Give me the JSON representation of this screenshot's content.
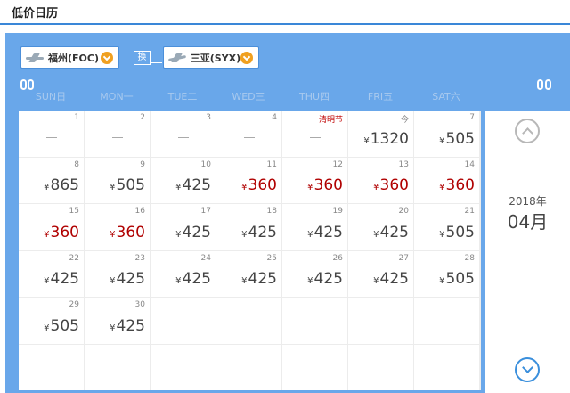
{
  "header": {
    "title": "低价日历"
  },
  "route": {
    "from": {
      "city": "福州(FOC)",
      "icon": "plane-takeoff-icon"
    },
    "swap_label": "换",
    "to": {
      "city": "三亚(SYX)",
      "icon": "plane-landing-icon"
    }
  },
  "weekdays": [
    "SUN日",
    "MON一",
    "TUE二",
    "WED三",
    "THU四",
    "FRI五",
    "SAT六"
  ],
  "calendar": {
    "year_label": "2018年",
    "month_label": "04月",
    "currency": "¥",
    "accent_low_color": "#b00000",
    "days": [
      {
        "day": "1",
        "price": null
      },
      {
        "day": "2",
        "price": null
      },
      {
        "day": "3",
        "price": null
      },
      {
        "day": "4",
        "price": null
      },
      {
        "day": "清明节",
        "price": null,
        "holiday": true
      },
      {
        "day": "今",
        "price": "1320"
      },
      {
        "day": "7",
        "price": "505"
      },
      {
        "day": "8",
        "price": "865"
      },
      {
        "day": "9",
        "price": "505"
      },
      {
        "day": "10",
        "price": "425"
      },
      {
        "day": "11",
        "price": "360",
        "low": true
      },
      {
        "day": "12",
        "price": "360",
        "low": true
      },
      {
        "day": "13",
        "price": "360",
        "low": true
      },
      {
        "day": "14",
        "price": "360",
        "low": true
      },
      {
        "day": "15",
        "price": "360",
        "low": true
      },
      {
        "day": "16",
        "price": "360",
        "low": true
      },
      {
        "day": "17",
        "price": "425"
      },
      {
        "day": "18",
        "price": "425"
      },
      {
        "day": "19",
        "price": "425"
      },
      {
        "day": "20",
        "price": "425"
      },
      {
        "day": "21",
        "price": "505"
      },
      {
        "day": "22",
        "price": "425"
      },
      {
        "day": "23",
        "price": "425"
      },
      {
        "day": "24",
        "price": "425"
      },
      {
        "day": "25",
        "price": "425"
      },
      {
        "day": "26",
        "price": "425"
      },
      {
        "day": "27",
        "price": "425"
      },
      {
        "day": "28",
        "price": "505"
      },
      {
        "day": "29",
        "price": "505"
      },
      {
        "day": "30",
        "price": "425"
      }
    ]
  }
}
